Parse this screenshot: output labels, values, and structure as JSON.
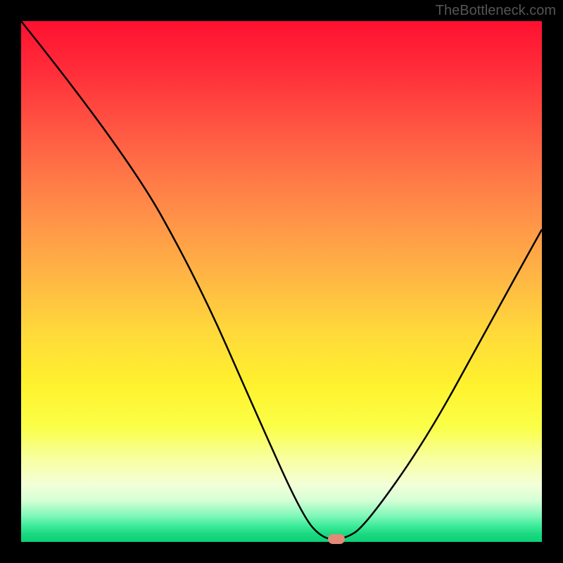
{
  "watermark": "TheBottleneck.com",
  "chart_data": {
    "type": "line",
    "title": "",
    "xlabel": "",
    "ylabel": "",
    "xlim": [
      0,
      1
    ],
    "ylim": [
      0,
      1
    ],
    "series": [
      {
        "name": "bottleneck-curve",
        "points": [
          {
            "x": 0.0,
            "y": 1.0
          },
          {
            "x": 0.2,
            "y": 0.75
          },
          {
            "x": 0.34,
            "y": 0.5
          },
          {
            "x": 0.45,
            "y": 0.25
          },
          {
            "x": 0.54,
            "y": 0.05
          },
          {
            "x": 0.58,
            "y": 0.005
          },
          {
            "x": 0.62,
            "y": 0.005
          },
          {
            "x": 0.66,
            "y": 0.03
          },
          {
            "x": 0.78,
            "y": 0.2
          },
          {
            "x": 0.9,
            "y": 0.42
          },
          {
            "x": 1.0,
            "y": 0.6
          }
        ]
      }
    ],
    "marker": {
      "x": 0.605,
      "y": 0.005
    },
    "gradient_stops": [
      {
        "pos": 0.0,
        "color": "#ff1030"
      },
      {
        "pos": 0.5,
        "color": "#ffda3a"
      },
      {
        "pos": 0.95,
        "color": "#7ff7b8"
      },
      {
        "pos": 1.0,
        "color": "#0bd176"
      }
    ]
  }
}
